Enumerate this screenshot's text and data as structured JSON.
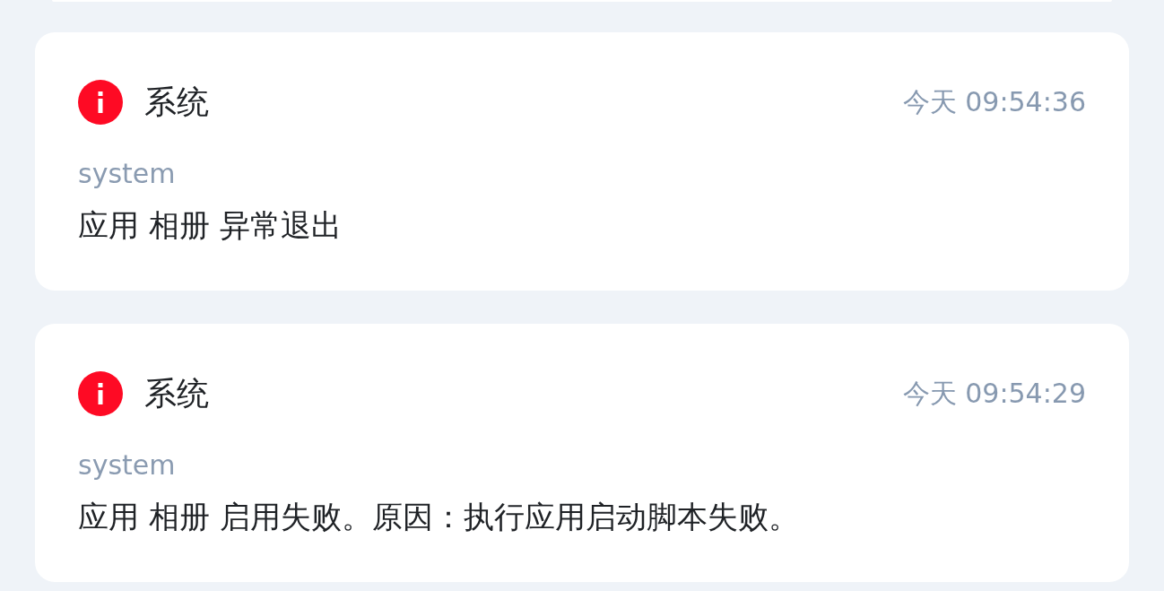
{
  "notifications": [
    {
      "title": "系统",
      "time": "今天 09:54:36",
      "source": "system",
      "message": "应用 相册 异常退出"
    },
    {
      "title": "系统",
      "time": "今天 09:54:29",
      "source": "system",
      "message": "应用 相册 启用失败。原因：执行应用启动脚本失败。"
    }
  ]
}
